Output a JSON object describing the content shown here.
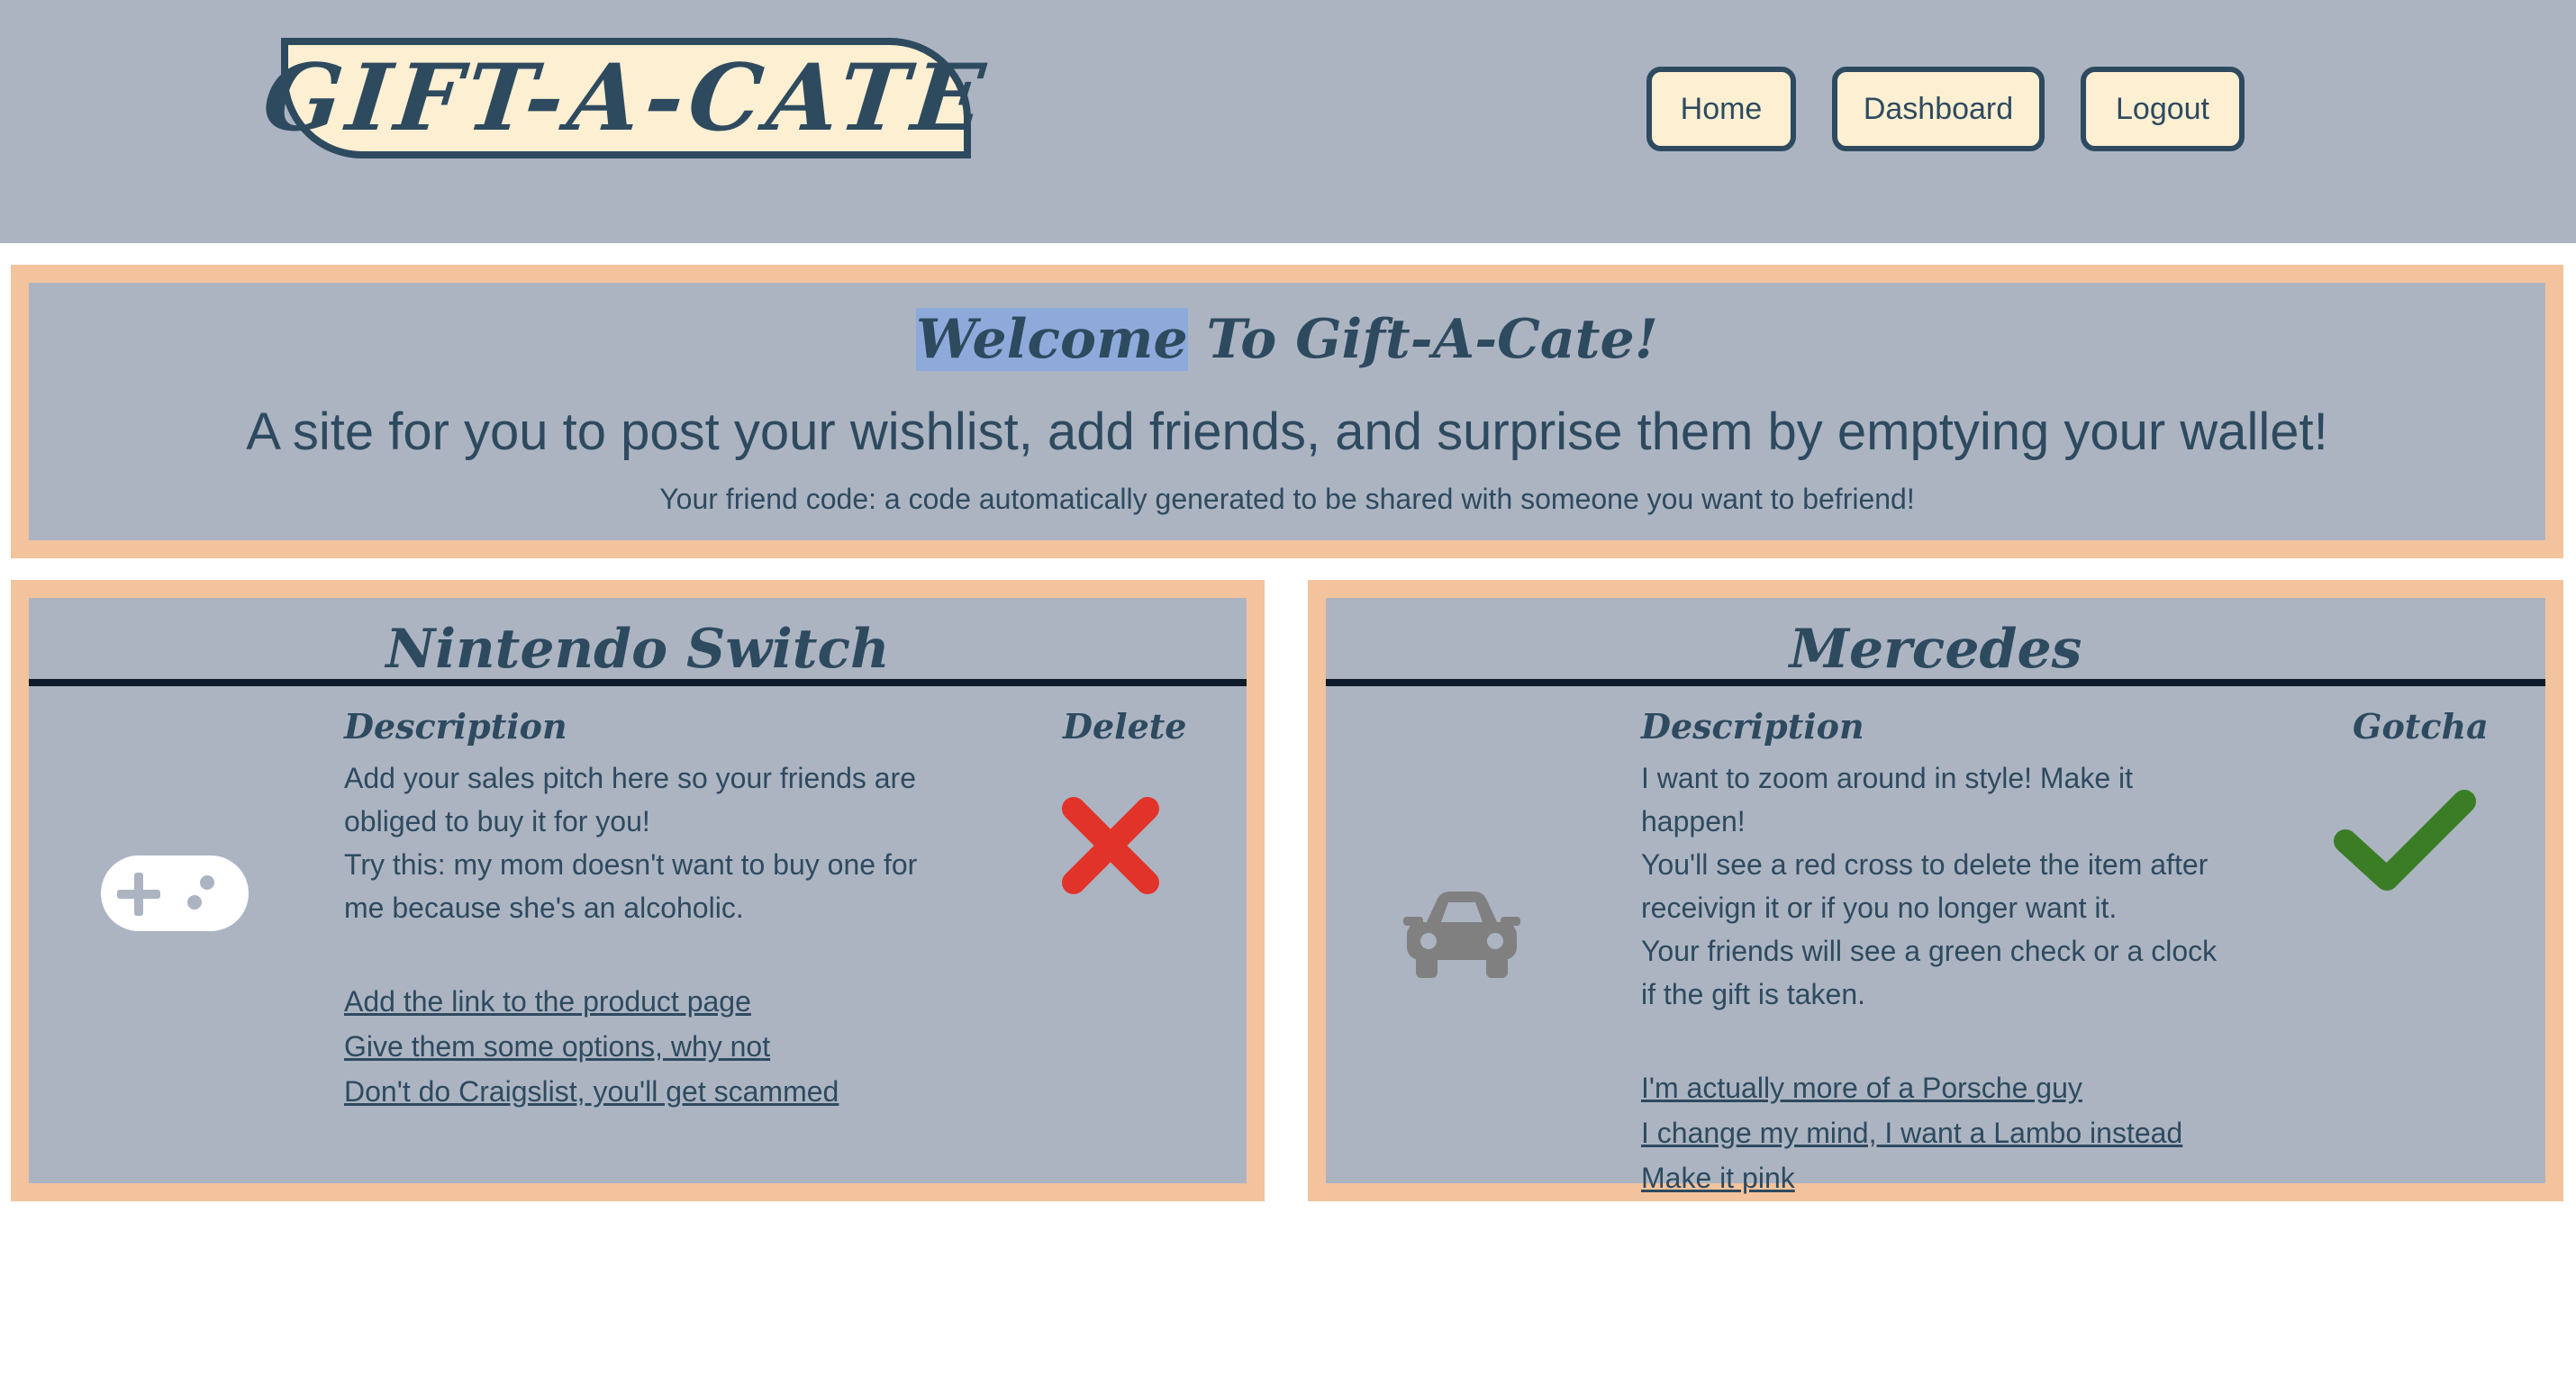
{
  "header": {
    "logo": "GIFT-A-CATE",
    "nav": [
      {
        "label": "Home"
      },
      {
        "label": "Dashboard"
      },
      {
        "label": "Logout"
      }
    ]
  },
  "welcome": {
    "title_highlight": "Welcome",
    "title_rest": " To Gift-A-Cate!",
    "subtitle": "A site for you to post your wishlist, add friends, and surprise them by emptying your wallet!",
    "friend_code": "Your friend code: a code automatically generated to be shared with someone you want to befriend!"
  },
  "gifts": [
    {
      "title": "Nintendo Switch",
      "icon": "gamepad-icon",
      "description_heading": "Description",
      "action_heading": "Delete",
      "action_icon": "red-cross-icon",
      "description": [
        "Add your sales pitch here so your friends are obliged to buy it for you!",
        "Try this: my mom doesn't want to buy one for me because she's an alcoholic."
      ],
      "links": [
        "Add the link to the product page",
        "Give them some options, why not",
        "Don't do Craigslist, you'll get scammed"
      ]
    },
    {
      "title": "Mercedes",
      "icon": "car-icon",
      "description_heading": "Description",
      "action_heading": "Gotcha",
      "action_icon": "green-check-icon",
      "description": [
        "I want to zoom around in style! Make it happen!",
        "You'll see a red cross to delete the item after receivign it or if you no longer want it.",
        "Your friends will see a green check or a clock if the gift is taken."
      ],
      "links": [
        "I'm actually more of a Porsche guy",
        "I change my mind, I want a Lambo instead",
        "Make it pink"
      ]
    }
  ],
  "colors": {
    "panel_bg": "#acb4c2",
    "panel_border": "#f3c39d",
    "cream": "#fcefd2",
    "navy": "#2e4a5f",
    "delete_red": "#e2332a",
    "check_green": "#3a7d24"
  }
}
